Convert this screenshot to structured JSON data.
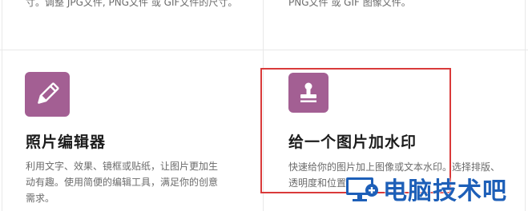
{
  "top": {
    "left_text": "寸。调整 JPG文件, PNG文件 或 GIF文件的尺寸。",
    "right_text": "PNG文件 或 GIF 图像文件。"
  },
  "cards": [
    {
      "title": "照片编辑器",
      "description": "利用文字、效果、镜框或贴纸，让图片更加生动有趣。使用简便的编辑工具，满足你的创意需求。",
      "icon": "pencil-icon"
    },
    {
      "title": "给一个图片加水印",
      "description": "快速给你的图片加上图像或文本水印。选择排版、透明度和位置。",
      "icon": "stamp-icon"
    }
  ],
  "colors": {
    "accent": "#a35f93",
    "highlight_border": "#d93a3a",
    "watermark": "#1d5fb8"
  },
  "watermark_text": "电脑技术吧"
}
